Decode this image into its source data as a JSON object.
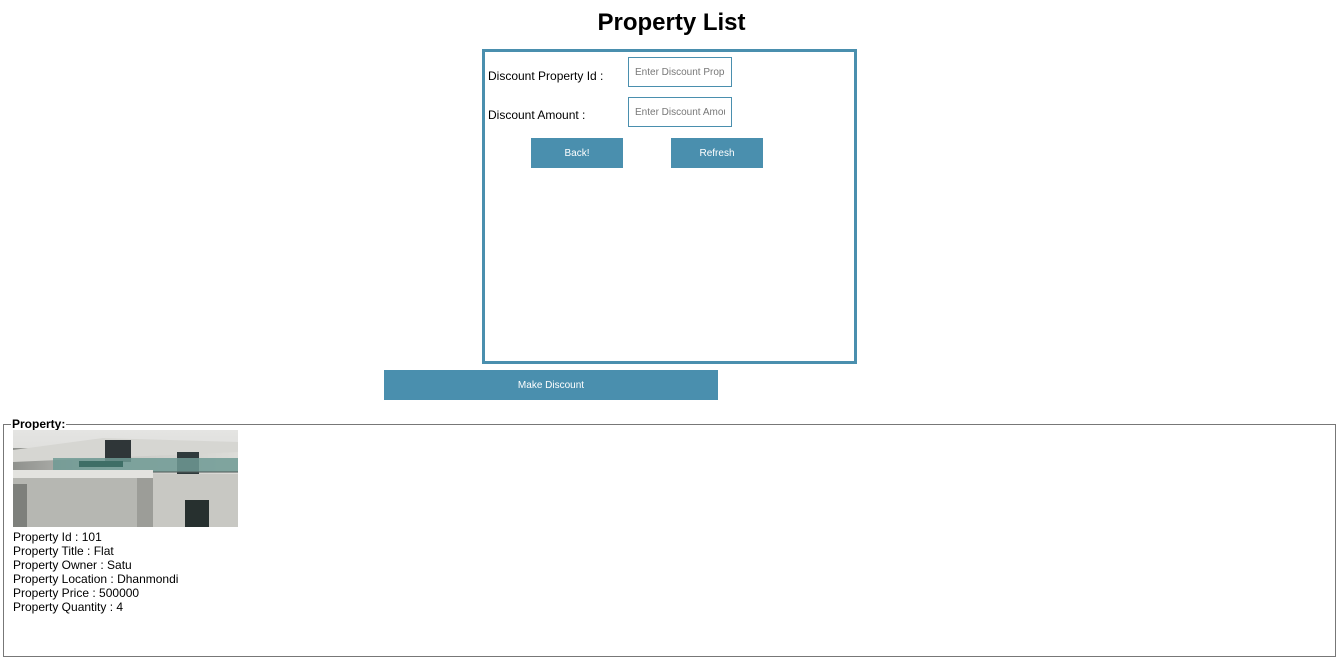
{
  "page": {
    "title": "Property List"
  },
  "form": {
    "discount_id_label": "Discount Property Id :",
    "discount_id_placeholder": "Enter Discount Property Id",
    "discount_amount_label": "Discount Amount :",
    "discount_amount_placeholder": "Enter Discount Amount",
    "back_label": "Back!",
    "refresh_label": "Refresh"
  },
  "make_discount_label": "Make Discount",
  "property_section": {
    "legend": "Property:",
    "photo_icon": "building-photo",
    "details": [
      {
        "label": "Property Id",
        "sep": " : ",
        "value": "101"
      },
      {
        "label": "Property Title",
        "sep": " : ",
        "value": "Flat"
      },
      {
        "label": "Property Owner",
        "sep": " : ",
        "value": "Satu"
      },
      {
        "label": "Property Location",
        "sep": " : ",
        "value": "Dhanmondi"
      },
      {
        "label": "Property Price",
        "sep": " : ",
        "value": "500000"
      },
      {
        "label": "Property Quantity",
        "sep": " : ",
        "value": "4"
      }
    ]
  },
  "colors": {
    "accent": "#4a8fae"
  }
}
